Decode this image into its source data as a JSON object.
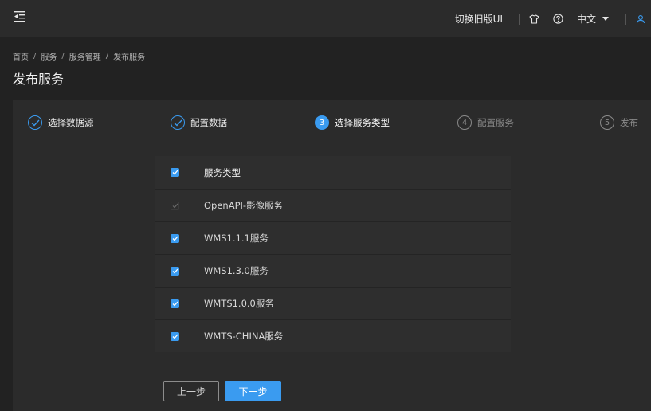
{
  "topbar": {
    "switch_ui": "切换旧版UI",
    "language": "中文",
    "icons": [
      "menu-fold-icon",
      "tshirt-icon",
      "help-icon",
      "user-icon"
    ]
  },
  "breadcrumb": [
    "首页",
    "服务",
    "服务管理",
    "发布服务"
  ],
  "page_title": "发布服务",
  "steps": [
    {
      "number": "1",
      "label": "选择数据源",
      "status": "done"
    },
    {
      "number": "2",
      "label": "配置数据",
      "status": "done"
    },
    {
      "number": "3",
      "label": "选择服务类型",
      "status": "active"
    },
    {
      "number": "4",
      "label": "配置服务",
      "status": "todo"
    },
    {
      "number": "5",
      "label": "发布",
      "status": "todo"
    }
  ],
  "service_table": {
    "header": "服务类型",
    "rows": [
      {
        "label": "OpenAPI-影像服务",
        "checked": true,
        "disabled": true
      },
      {
        "label": "WMS1.1.1服务",
        "checked": true,
        "disabled": false
      },
      {
        "label": "WMS1.3.0服务",
        "checked": true,
        "disabled": false
      },
      {
        "label": "WMTS1.0.0服务",
        "checked": true,
        "disabled": false
      },
      {
        "label": "WMTS-CHINA服务",
        "checked": true,
        "disabled": false
      }
    ]
  },
  "buttons": {
    "prev": "上一步",
    "next": "下一步"
  },
  "colors": {
    "accent": "#3a9bf0",
    "background": "#222222",
    "panel": "#2b2b2b"
  }
}
